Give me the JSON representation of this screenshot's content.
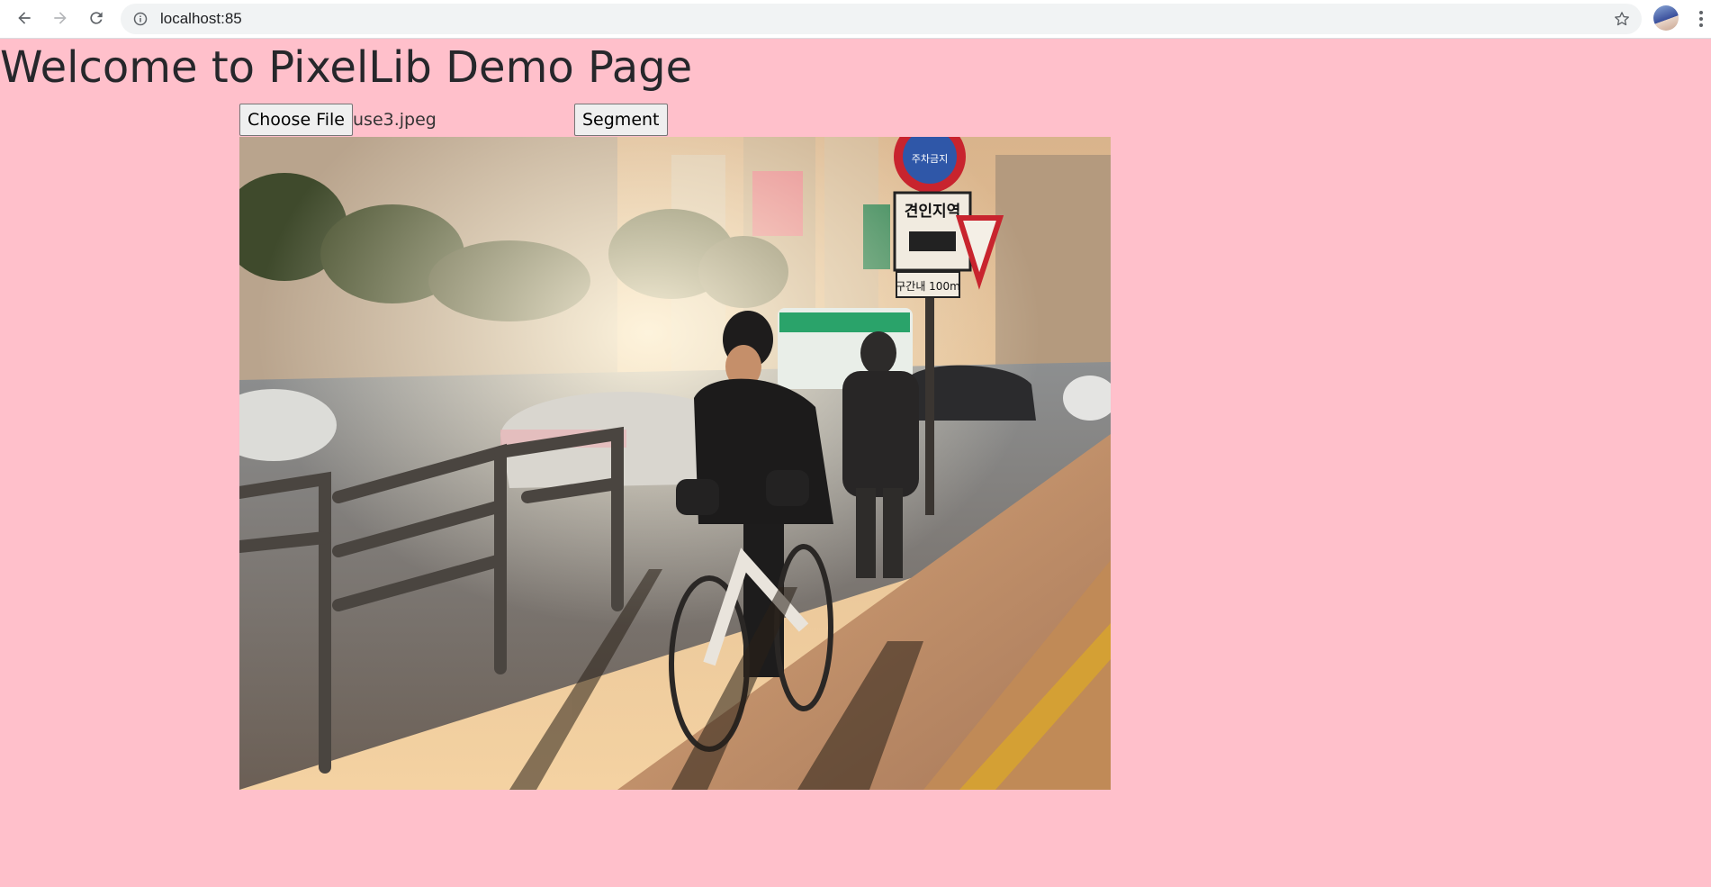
{
  "browser": {
    "url": "localhost:85",
    "icons": {
      "back": "arrow-left-icon",
      "forward": "arrow-right-icon",
      "reload": "reload-icon",
      "site_info": "info-icon",
      "bookmark": "star-icon",
      "profile": "avatar",
      "menu": "kebab-menu-icon"
    }
  },
  "page": {
    "title": "Welcome to PixelLib Demo Page",
    "background_color": "#ffc0cb"
  },
  "form": {
    "choose_file_label": "Choose File",
    "file_name": "use3.jpeg",
    "segment_label": "Segment"
  },
  "image": {
    "alt": "use3.jpeg",
    "sign_top": "주차금지",
    "sign_middle": "견인지역",
    "sign_bottom": "구간내 100m"
  }
}
